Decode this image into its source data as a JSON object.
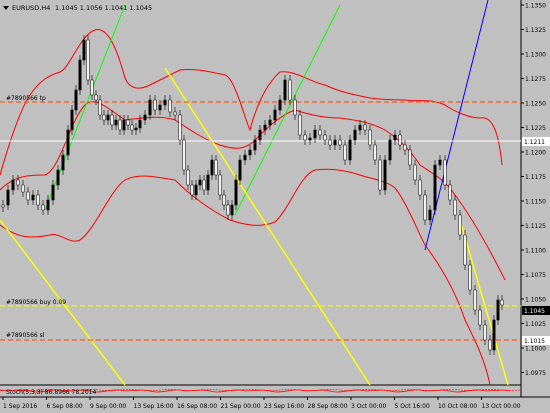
{
  "window": {
    "symbol_label": "EURUSD,H4",
    "ohlc": "1.1045 1.1056 1.1041 1.1045"
  },
  "price_axis": {
    "ticks": [
      "1.1350",
      "1.1325",
      "1.1300",
      "1.1275",
      "1.1250",
      "1.1225",
      "1.1200",
      "1.1175",
      "1.1150",
      "1.1125",
      "1.1100",
      "1.1075",
      "1.1050",
      "1.1025",
      "1.1000",
      "1.0975"
    ],
    "current_price": "1.1045",
    "marker_upper": "1.1211",
    "marker_lower": "1.1015"
  },
  "time_axis": {
    "labels": [
      "1 Sep 2016",
      "6 Sep 08:00",
      "9 Sep 00:00",
      "13 Sep 16:00",
      "16 Sep 08:00",
      "21 Sep 00:00",
      "23 Sep 16:00",
      "28 Sep 08:00",
      "3 Oct 00:00",
      "5 Oct 16:00",
      "10 Oct 08:00",
      "13 Oct 00:00"
    ]
  },
  "order_lines": {
    "tp_label": "#7890566 tp",
    "buy_label": "#7890566 buy 0.09",
    "sl_label": "#7890566 sl"
  },
  "indicator": {
    "label": "Stoch(5,3,3) 86.8966 78.2014"
  },
  "colors": {
    "background": "#c0c0c0",
    "candle": "#000000",
    "bands": "#ff0000",
    "trend_green": "#00ff00",
    "trend_yellow": "#ffff00",
    "trend_blue": "#0000ff",
    "order_line": "#ff4500"
  }
}
